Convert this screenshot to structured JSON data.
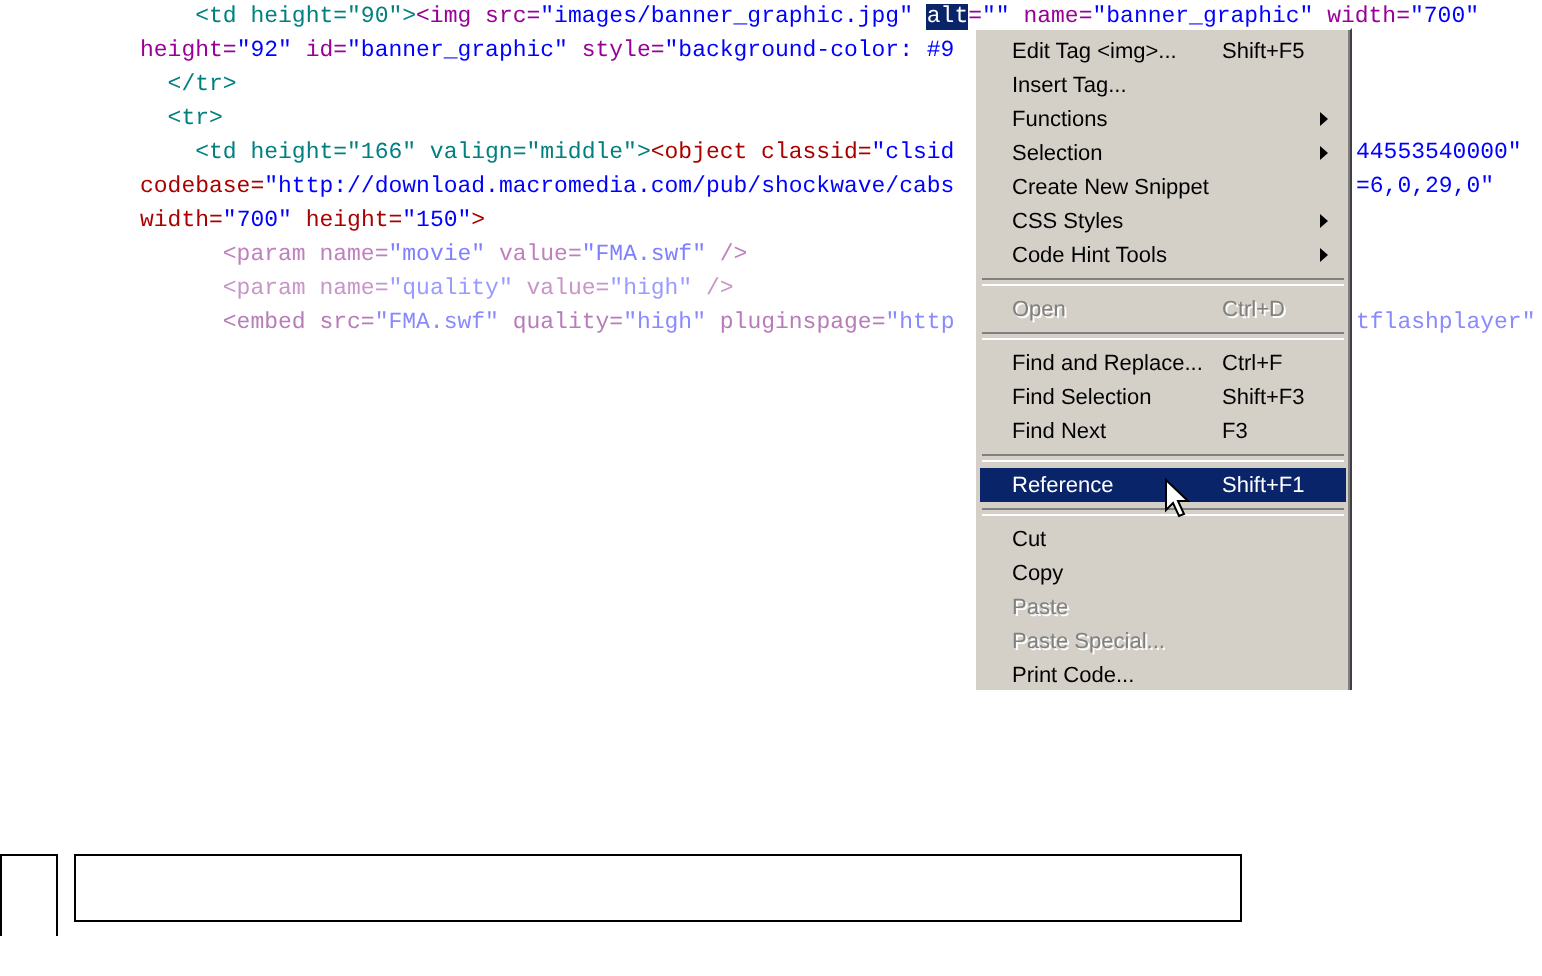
{
  "code_lines": [
    {
      "left": [
        {
          "text": "    <td height=\"90\">",
          "color": "#008080"
        },
        {
          "text": "<img src=",
          "color": "#990099"
        },
        {
          "text": "\"images/banner_graphic.jpg\" ",
          "color": "#0000ff"
        },
        {
          "text": "alt",
          "selected": true
        },
        {
          "text": "=",
          "color": "#990099"
        },
        {
          "text": "\"\"",
          "color": "#0000ff"
        },
        {
          "text": " name=",
          "color": "#990099"
        },
        {
          "text": "\"banner_graphic\"",
          "color": "#0000ff"
        },
        {
          "text": " width=",
          "color": "#990099"
        },
        {
          "text": "\"700\"",
          "color": "#0000ff"
        }
      ],
      "full": true
    },
    {
      "left": [
        {
          "text": "height=",
          "color": "#990099"
        },
        {
          "text": "\"92\"",
          "color": "#0000ff"
        },
        {
          "text": " id=",
          "color": "#990099"
        },
        {
          "text": "\"banner_graphic\"",
          "color": "#0000ff"
        },
        {
          "text": " style=",
          "color": "#990099"
        },
        {
          "text": "\"background-color: #9",
          "color": "#0000ff"
        }
      ]
    },
    {
      "left": [
        {
          "text": "  </tr>",
          "color": "#008080"
        }
      ]
    },
    {
      "left": [
        {
          "text": "  <tr>",
          "color": "#008080"
        }
      ]
    },
    {
      "left": [
        {
          "text": "    <td height=\"166\" valign=\"middle\">",
          "color": "#008080"
        },
        {
          "text": "<object classid=",
          "color": "#aa0000"
        },
        {
          "text": "\"clsid",
          "color": "#0000ff"
        }
      ],
      "right": [
        {
          "text": "44553540000\"",
          "color": "#0000ff"
        }
      ]
    },
    {
      "left": [
        {
          "text": "codebase=",
          "color": "#aa0000"
        },
        {
          "text": "\"http://download.macromedia.com/pub/shockwave/cabs",
          "color": "#0000ff"
        }
      ],
      "right": [
        {
          "text": "=6,0,29,0\"",
          "color": "#0000ff"
        }
      ]
    },
    {
      "left": [
        {
          "text": "width=",
          "color": "#aa0000"
        },
        {
          "text": "\"700\"",
          "color": "#0000ff"
        },
        {
          "text": " height=",
          "color": "#aa0000"
        },
        {
          "text": "\"150\"",
          "color": "#0000ff"
        },
        {
          "text": ">",
          "color": "#aa0000"
        }
      ]
    },
    {
      "left": [
        {
          "text": "      <param name=",
          "color": "#c080c0"
        },
        {
          "text": "\"movie\"",
          "color": "#7f7fff"
        },
        {
          "text": " value=",
          "color": "#c080c0"
        },
        {
          "text": "\"FMA.swf\"",
          "color": "#7f7fff"
        },
        {
          "text": " />",
          "color": "#c080c0"
        }
      ]
    },
    {
      "left": [
        {
          "text": "      <param name=",
          "color": "#c896c8"
        },
        {
          "text": "\"quality\"",
          "color": "#9a9aff"
        },
        {
          "text": " value=",
          "color": "#c896c8"
        },
        {
          "text": "\"high\"",
          "color": "#9a9aff"
        },
        {
          "text": " />",
          "color": "#c896c8"
        }
      ]
    },
    {
      "left": [
        {
          "text": "      <embed src=",
          "color": "#b87cb8"
        },
        {
          "text": "\"FMA.swf\"",
          "color": "#8a8aff"
        },
        {
          "text": " quality=",
          "color": "#b87cb8"
        },
        {
          "text": "\"high\"",
          "color": "#8a8aff"
        },
        {
          "text": " pluginspage=",
          "color": "#b87cb8"
        },
        {
          "text": "\"http",
          "color": "#8a8aff"
        }
      ],
      "right": [
        {
          "text": "tflashplayer\"",
          "color": "#8a8aff"
        }
      ]
    }
  ],
  "context_menu": [
    {
      "kind": "item",
      "label": "Edit Tag <img>...",
      "shortcut": "Shift+F5",
      "submenu": false,
      "disabled": false,
      "selected": false
    },
    {
      "kind": "item",
      "label": "Insert Tag...",
      "submenu": false,
      "disabled": false,
      "selected": false
    },
    {
      "kind": "item",
      "label": "Functions",
      "submenu": true,
      "disabled": false,
      "selected": false
    },
    {
      "kind": "item",
      "label": "Selection",
      "submenu": true,
      "disabled": false,
      "selected": false
    },
    {
      "kind": "item",
      "label": "Create New Snippet",
      "submenu": false,
      "disabled": false,
      "selected": false
    },
    {
      "kind": "item",
      "label": "CSS Styles",
      "submenu": true,
      "disabled": false,
      "selected": false
    },
    {
      "kind": "item",
      "label": "Code Hint Tools",
      "submenu": true,
      "disabled": false,
      "selected": false
    },
    {
      "kind": "separator"
    },
    {
      "kind": "item",
      "label": "Open",
      "shortcut": "Ctrl+D",
      "submenu": false,
      "disabled": true,
      "selected": false
    },
    {
      "kind": "separator"
    },
    {
      "kind": "item",
      "label": "Find and Replace...",
      "shortcut": "Ctrl+F",
      "submenu": false,
      "disabled": false,
      "selected": false
    },
    {
      "kind": "item",
      "label": "Find Selection",
      "shortcut": "Shift+F3",
      "submenu": false,
      "disabled": false,
      "selected": false
    },
    {
      "kind": "item",
      "label": "Find Next",
      "shortcut": "F3",
      "submenu": false,
      "disabled": false,
      "selected": false
    },
    {
      "kind": "separator"
    },
    {
      "kind": "item",
      "label": "Reference",
      "shortcut": "Shift+F1",
      "submenu": false,
      "disabled": false,
      "selected": true
    },
    {
      "kind": "separator"
    },
    {
      "kind": "item",
      "label": "Cut",
      "submenu": false,
      "disabled": false,
      "selected": false
    },
    {
      "kind": "item",
      "label": "Copy",
      "submenu": false,
      "disabled": false,
      "selected": false
    },
    {
      "kind": "item",
      "label": "Paste",
      "submenu": false,
      "disabled": true,
      "selected": false
    },
    {
      "kind": "item",
      "label": "Paste Special...",
      "submenu": false,
      "disabled": true,
      "selected": false
    },
    {
      "kind": "item",
      "label": "Print Code...",
      "submenu": false,
      "disabled": false,
      "selected": false
    }
  ]
}
